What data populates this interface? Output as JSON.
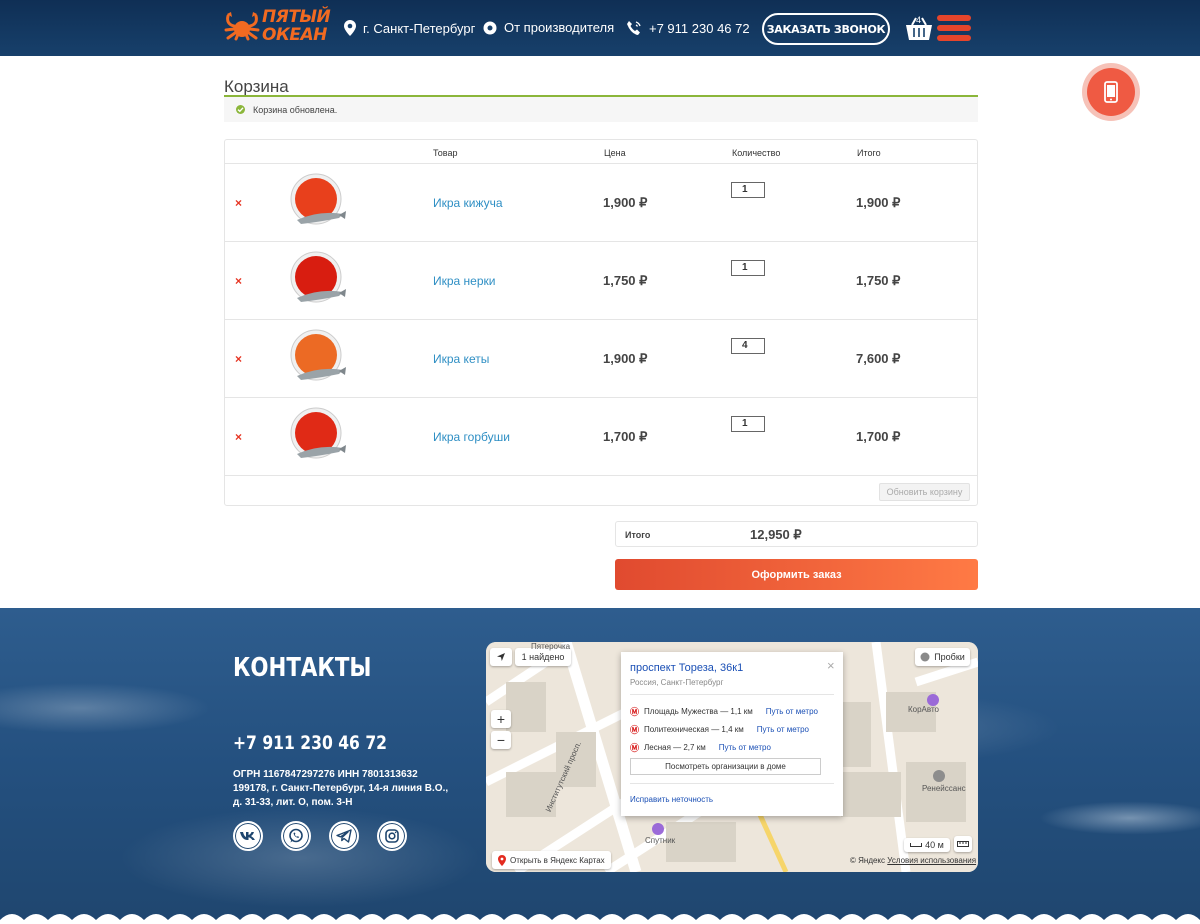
{
  "header": {
    "logo_line1": "ПЯТЫЙ",
    "logo_line2": "ОКЕАН",
    "city": "г. Санкт-Петербург",
    "producer": "От производителя",
    "phone": "+7 911 230 46 72",
    "call_button": "Заказать звонок",
    "cart_count": "4"
  },
  "cart": {
    "title": "Корзина",
    "notice": "Корзина обновлена.",
    "columns": {
      "product": "Товар",
      "price": "Цена",
      "quantity": "Количество",
      "total": "Итого"
    },
    "items": [
      {
        "remove": "×",
        "name": "Икра кижуча",
        "price": "1,900 ₽",
        "qty": "1",
        "total": "1,900 ₽",
        "color": "#e8401c"
      },
      {
        "remove": "×",
        "name": "Икра нерки",
        "price": "1,750 ₽",
        "qty": "1",
        "total": "1,750 ₽",
        "color": "#d81d10"
      },
      {
        "remove": "×",
        "name": "Икра кеты",
        "price": "1,900 ₽",
        "qty": "4",
        "total": "7,600 ₽",
        "color": "#ec6a24"
      },
      {
        "remove": "×",
        "name": "Икра горбуши",
        "price": "1,700 ₽",
        "qty": "1",
        "total": "1,700 ₽",
        "color": "#e02a16"
      }
    ],
    "update_button": "Обновить корзину",
    "totals_label": "Итого",
    "totals_value": "12,950 ₽",
    "checkout_button": "Оформить заказ"
  },
  "footer": {
    "contacts_title": "КОНТАКТЫ",
    "phone": "+7 911 230 46 72",
    "requisites": [
      "ОГРН 1167847297276 ИНН 7801313632",
      "199178, г. Санкт-Петербург, 14-я линия В.О.,",
      "д. 31-33, лит. О, пом. 3-Н"
    ],
    "socials": [
      "vk-icon",
      "whatsapp-icon",
      "telegram-icon",
      "instagram-icon"
    ]
  },
  "map": {
    "found": "1 найдено",
    "traffic": "Пробки",
    "zoom_in": "+",
    "zoom_out": "−",
    "popup": {
      "address": "проспект Тореза, 36к1",
      "city": "Россия, Санкт-Петербург",
      "metro": [
        {
          "station": "Площадь Мужества — 1,1 км",
          "link": "Путь от метро"
        },
        {
          "station": "Политехническая — 1,4 км",
          "link": "Путь от метро"
        },
        {
          "station": "Лесная — 2,7 км",
          "link": "Путь от метро"
        }
      ],
      "orgs_button": "Посмотреть организации в доме",
      "fix_link": "Исправить неточность"
    },
    "open_link": "Открыть в Яндекс Картах",
    "copyright": "© Яндекс",
    "terms": "Условия использования",
    "scale": "40 м",
    "labels": {
      "pyaterochka": "Пятерочка",
      "sputnik": "Спутник",
      "koravto": "КорАвто",
      "renessans": "Ренейссанс",
      "street": "Институтский просп."
    }
  }
}
